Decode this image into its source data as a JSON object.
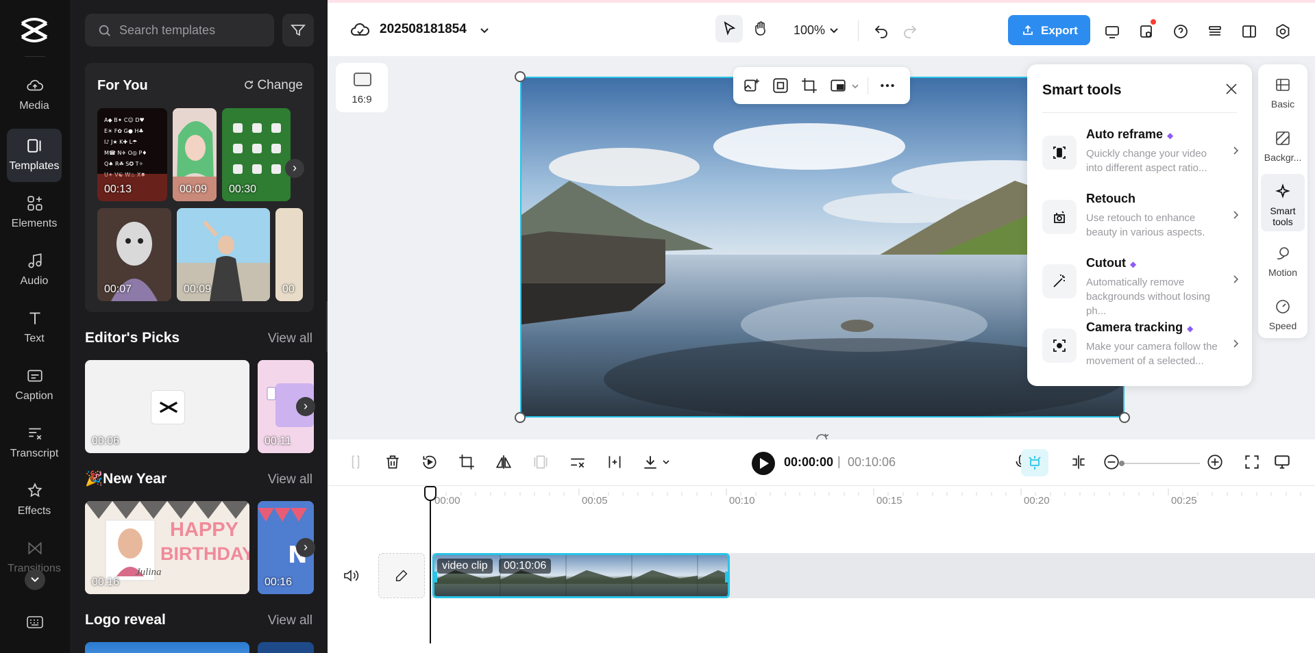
{
  "rail": {
    "items": [
      {
        "label": "Media"
      },
      {
        "label": "Templates"
      },
      {
        "label": "Elements"
      },
      {
        "label": "Audio"
      },
      {
        "label": "Text"
      },
      {
        "label": "Caption"
      },
      {
        "label": "Transcript"
      },
      {
        "label": "Effects"
      },
      {
        "label": "Transitions"
      }
    ]
  },
  "panel": {
    "search_placeholder": "Search templates",
    "for_you": {
      "title": "For You",
      "change": "Change",
      "durations": [
        "00:13",
        "00:09",
        "00:30",
        "00:07",
        "00:09",
        "00"
      ]
    },
    "editors_picks": {
      "title": "Editor's Picks",
      "view_all": "View all",
      "durations": [
        "00:06",
        "00:11"
      ]
    },
    "new_year": {
      "title": "🎉New Year",
      "view_all": "View all",
      "durations": [
        "00:16",
        "00:16"
      ],
      "card_text_1": "HAPPY",
      "card_text_2": "BIRTHDAY",
      "card_text_3": "Julina"
    },
    "logo_reveal": {
      "title": "Logo reveal",
      "view_all": "View all"
    }
  },
  "topbar": {
    "project_name": "202508181854",
    "zoom": "100%",
    "export": "Export"
  },
  "canvas": {
    "ratio": "16:9"
  },
  "smart_tools": {
    "title": "Smart tools",
    "tools": [
      {
        "name": "Auto reframe",
        "desc": "Quickly change your video into different aspect ratio..."
      },
      {
        "name": "Retouch",
        "desc": "Use retouch to enhance beauty in various aspects."
      },
      {
        "name": "Cutout",
        "desc": "Automatically remove backgrounds without losing ph..."
      },
      {
        "name": "Camera tracking",
        "desc": "Make your camera follow the movement of a selected..."
      }
    ]
  },
  "right_rail": {
    "items": [
      {
        "label": "Basic"
      },
      {
        "label": "Backgr..."
      },
      {
        "label": "Smart tools"
      },
      {
        "label": "Motion"
      },
      {
        "label": "Speed"
      }
    ]
  },
  "timeline": {
    "current_time": "00:00:00",
    "separator": "|",
    "total_time": "00:10:06",
    "ruler": [
      "00:00",
      "00:05",
      "00:10",
      "00:15",
      "00:20",
      "00:25"
    ],
    "clip_label": "video clip",
    "clip_duration": "00:10:06"
  },
  "colors": {
    "accent": "#28c4e8",
    "export": "#2d8cf0",
    "rail_bg": "#121212",
    "panel_bg": "#1c1c1e"
  }
}
